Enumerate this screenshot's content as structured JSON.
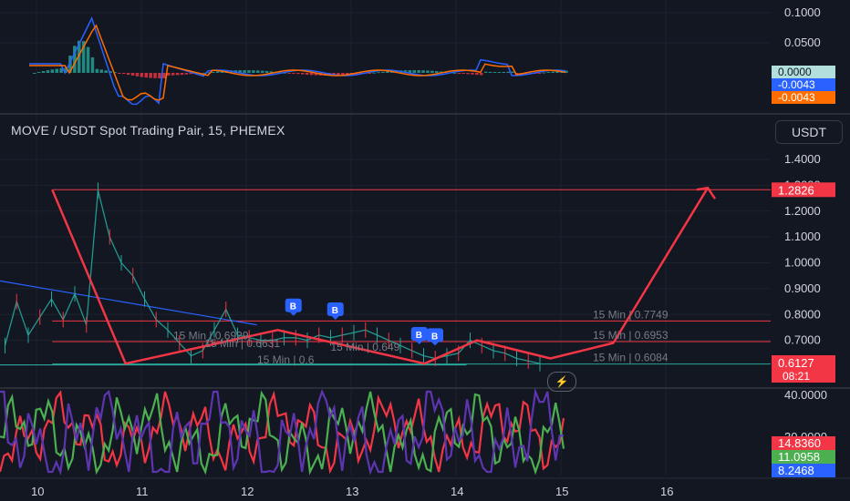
{
  "header": {
    "symbol_title": "MOVE / USDT Spot Trading Pair, 15, PHEMEX",
    "currency_button": "USDT"
  },
  "colors": {
    "background": "#131722",
    "red": "#f23645",
    "green": "#4caf50",
    "blue": "#2962ff",
    "orange": "#ff6d00",
    "purple": "#7b1fa2",
    "teal": "#26a69a",
    "grid": "#1e222d",
    "axis_text": "#d1d4dc"
  },
  "chart_data": [
    {
      "type": "bar",
      "panel": "macd",
      "yticks": [
        "0.1000",
        "0.0500"
      ],
      "last_values": [
        {
          "text": "0.0000",
          "color": "#b2dfdb",
          "text_color": "#131722"
        },
        {
          "text": "-0.0043",
          "color": "#2962ff",
          "text_color": "#ffffff"
        },
        {
          "text": "-0.0043",
          "color": "#ff6d00",
          "text_color": "#ffffff"
        }
      ]
    },
    {
      "type": "line",
      "panel": "price",
      "yticks": [
        "1.4000",
        "1.3000",
        "1.2000",
        "1.1000",
        "1.0000",
        "0.9000",
        "0.8000",
        "0.7000"
      ],
      "ylim": [
        0.6,
        1.4
      ],
      "last_price": "0.6127",
      "countdown": "08:21",
      "target_price": "1.2826",
      "close": [
        0.68,
        0.85,
        0.72,
        0.79,
        0.86,
        0.78,
        0.88,
        0.76,
        1.28,
        1.1,
        1.0,
        0.95,
        0.86,
        0.78,
        0.74,
        0.69,
        0.64,
        0.66,
        0.74,
        0.82,
        0.72,
        0.71,
        0.7,
        0.7,
        0.71,
        0.71,
        0.7,
        0.72,
        0.71,
        0.72,
        0.73,
        0.74,
        0.72,
        0.7,
        0.68,
        0.66,
        0.64,
        0.63,
        0.64,
        0.65,
        0.7,
        0.68,
        0.66,
        0.65,
        0.63,
        0.62,
        0.61
      ],
      "horizontal_lines": [
        {
          "y": 1.2826,
          "color": "#f23645"
        },
        {
          "y": 0.7749,
          "color": "#f23645"
        },
        {
          "y": 0.6953,
          "color": "#f23645"
        },
        {
          "y": 0.6084,
          "color": "#26a69a"
        }
      ],
      "labels": [
        {
          "text": "15 Min | 0.7749",
          "y": 0.7749,
          "x": 16.0
        },
        {
          "text": "15 Min | 0.6953",
          "y": 0.6953,
          "x": 16.0
        },
        {
          "text": "15 Min | 0.6929",
          "y": 0.6929,
          "x": 12.0
        },
        {
          "text": "15 Min | 0.6631",
          "y": 0.6631,
          "x": 12.3
        },
        {
          "text": "15 Min | 0.649",
          "y": 0.649,
          "x": 13.5
        },
        {
          "text": "15 Min | 0.6084",
          "y": 0.6084,
          "x": 16.0
        },
        {
          "text": "15 Min | 0.6",
          "y": 0.6,
          "x": 12.8
        }
      ],
      "signals": [
        {
          "text": "B",
          "x": 12.45,
          "y": 0.83
        },
        {
          "text": "B",
          "x": 12.85,
          "y": 0.815
        },
        {
          "text": "B",
          "x": 13.65,
          "y": 0.72
        },
        {
          "text": "B",
          "x": 13.8,
          "y": 0.715
        }
      ],
      "drawing_path": [
        [
          10.15,
          1.2826
        ],
        [
          10.85,
          0.61
        ],
        [
          11.3,
          0.65
        ],
        [
          12.3,
          0.74
        ],
        [
          13.7,
          0.61
        ],
        [
          14.2,
          0.7
        ],
        [
          14.5,
          0.67
        ],
        [
          14.9,
          0.63
        ],
        [
          15.5,
          0.69
        ],
        [
          16.4,
          1.29
        ]
      ]
    },
    {
      "type": "line",
      "panel": "oscillator",
      "yticks": [
        "40.0000",
        "30.0000"
      ],
      "last_values": [
        {
          "text": "14.8360",
          "color": "#f23645"
        },
        {
          "text": "11.0958",
          "color": "#4caf50"
        },
        {
          "text": "8.2468",
          "color": "#2962ff"
        }
      ],
      "series": [
        {
          "name": "",
          "color": "#f23645"
        },
        {
          "name": "",
          "color": "#4caf50"
        },
        {
          "name": "",
          "color": "#5e35b1"
        }
      ]
    }
  ],
  "x_axis": {
    "ticks": [
      "10",
      "11",
      "12",
      "13",
      "14",
      "15",
      "16"
    ]
  }
}
